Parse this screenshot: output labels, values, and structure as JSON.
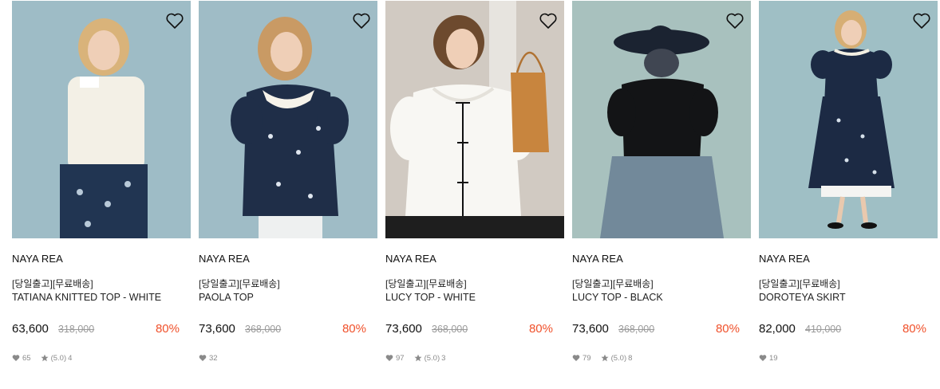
{
  "products": [
    {
      "brand": "NAYA REA",
      "tag": "[당일출고][무료배송]",
      "name": "TATIANA KNITTED TOP - WHITE",
      "price": "63,600",
      "original_price": "318,000",
      "discount": "80%",
      "likes": "65",
      "rating": "(5.0)",
      "reviews": "4",
      "has_reviews": true
    },
    {
      "brand": "NAYA REA",
      "tag": "[당일출고][무료배송]",
      "name": "PAOLA TOP",
      "price": "73,600",
      "original_price": "368,000",
      "discount": "80%",
      "likes": "32",
      "rating": "",
      "reviews": "",
      "has_reviews": false
    },
    {
      "brand": "NAYA REA",
      "tag": "[당일출고][무료배송]",
      "name": "LUCY TOP - WHITE",
      "price": "73,600",
      "original_price": "368,000",
      "discount": "80%",
      "likes": "97",
      "rating": "(5.0)",
      "reviews": "3",
      "has_reviews": true
    },
    {
      "brand": "NAYA REA",
      "tag": "[당일출고][무료배송]",
      "name": "LUCY TOP - BLACK",
      "price": "73,600",
      "original_price": "368,000",
      "discount": "80%",
      "likes": "79",
      "rating": "(5.0)",
      "reviews": "8",
      "has_reviews": true
    },
    {
      "brand": "NAYA REA",
      "tag": "[당일출고][무료배송]",
      "name": "DOROTEYA SKIRT",
      "price": "82,000",
      "original_price": "410,000",
      "discount": "80%",
      "likes": "19",
      "rating": "",
      "reviews": "",
      "has_reviews": false
    }
  ],
  "icons": {
    "wishlist": "heart-outline-icon",
    "likes": "heart-filled-icon",
    "rating": "star-icon"
  },
  "colors": {
    "discount": "#f0512b",
    "original_price": "#9a9a9a",
    "meta": "#8a8a8a"
  }
}
